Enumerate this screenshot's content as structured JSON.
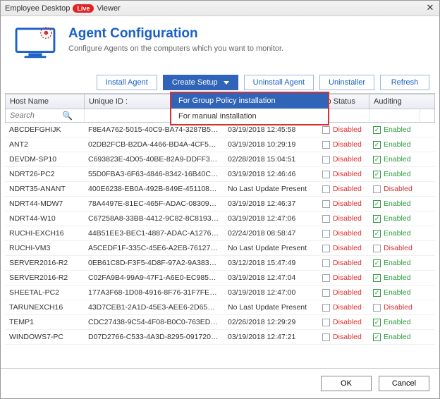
{
  "window": {
    "app_name": "Employee Desktop",
    "badge": "Live",
    "suffix": "Viewer"
  },
  "header": {
    "title": "Agent Configuration",
    "subtitle": "Configure Agents on the computers which you want to monitor."
  },
  "toolbar": {
    "install": "Install Agent",
    "create": "Create Setup",
    "uninstall_agent": "Uninstall Agent",
    "uninstaller": "Uninstaller",
    "refresh": "Refresh"
  },
  "dropdown": {
    "group_policy": "For Group Policy installation",
    "manual": "For manual installation"
  },
  "columns": {
    "host": "Host Name",
    "uid": "Unique ID :",
    "last": "",
    "jp": "Jp Status",
    "audit": "Auditing"
  },
  "search_placeholder": "Search",
  "status": {
    "disabled": "Disabled",
    "enabled": "Enabled"
  },
  "rows": [
    {
      "host": "ABCDEFGHIJK",
      "uid": "F8E4A762-5015-40C9-BA74-3287B597...",
      "ts": "03/19/2018 12:45:58",
      "jp": "Disabled",
      "audit": "Enabled"
    },
    {
      "host": "ANT2",
      "uid": "02DB2FCB-B2DA-4466-BD4A-4CF586...",
      "ts": "03/19/2018 10:29:19",
      "jp": "Disabled",
      "audit": "Enabled"
    },
    {
      "host": "DEVDM-SP10",
      "uid": "C693823E-4D05-40BE-82A9-DDFF313...",
      "ts": "02/28/2018 15:04:51",
      "jp": "Disabled",
      "audit": "Enabled"
    },
    {
      "host": "NDRT26-PC2",
      "uid": "55D0FBA3-6F63-4846-8342-16B40CB...",
      "ts": "03/19/2018 12:46:46",
      "jp": "Disabled",
      "audit": "Enabled"
    },
    {
      "host": "NDRT35-ANANT",
      "uid": "400E6238-EB0A-492B-849E-451108E...",
      "ts": "No Last Update Present",
      "jp": "Disabled",
      "audit": "Disabled"
    },
    {
      "host": "NDRT44-MDW7",
      "uid": "78A4497E-81EC-465F-ADAC-08309805...",
      "ts": "03/19/2018 12:46:37",
      "jp": "Disabled",
      "audit": "Enabled"
    },
    {
      "host": "NDRT44-W10",
      "uid": "C67258A8-33BB-4412-9C82-8C81930F...",
      "ts": "03/19/2018 12:47:06",
      "jp": "Disabled",
      "audit": "Enabled"
    },
    {
      "host": "RUCHI-EXCH16",
      "uid": "44B51EE3-BEC1-4887-ADAC-A1276115...",
      "ts": "02/24/2018 08:58:47",
      "jp": "Disabled",
      "audit": "Enabled"
    },
    {
      "host": "RUCHI-VM3",
      "uid": "A5CEDF1F-335C-45E6-A2EB-76127E3...",
      "ts": "No Last Update Present",
      "jp": "Disabled",
      "audit": "Disabled"
    },
    {
      "host": "SERVER2016-R2",
      "uid": "0EB61C8D-F3F5-4D8F-97A2-9A3838C...",
      "ts": "03/12/2018 15:47:49",
      "jp": "Disabled",
      "audit": "Enabled"
    },
    {
      "host": "SERVER2016-R2",
      "uid": "C02FA9B4-99A9-47F1-A6E0-EC985DA...",
      "ts": "03/19/2018 12:47:04",
      "jp": "Disabled",
      "audit": "Enabled"
    },
    {
      "host": "SHEETAL-PC2",
      "uid": "177A3F68-1D08-4916-8F76-31F7FEBA...",
      "ts": "03/19/2018 12:47:00",
      "jp": "Disabled",
      "audit": "Enabled"
    },
    {
      "host": "TARUNEXCH16",
      "uid": "43D7CEB1-2A1D-45E3-AEE6-2D65B9...",
      "ts": "No Last Update Present",
      "jp": "Disabled",
      "audit": "Disabled"
    },
    {
      "host": "TEMP1",
      "uid": "CDC27438-9C54-4F08-B0C0-763ED18...",
      "ts": "02/26/2018 12:29:29",
      "jp": "Disabled",
      "audit": "Enabled"
    },
    {
      "host": "WINDOWS7-PC",
      "uid": "D07D2766-C533-4A3D-8295-0917201...",
      "ts": "03/19/2018 12:47:21",
      "jp": "Disabled",
      "audit": "Enabled"
    }
  ],
  "footer": {
    "ok": "OK",
    "cancel": "Cancel"
  }
}
